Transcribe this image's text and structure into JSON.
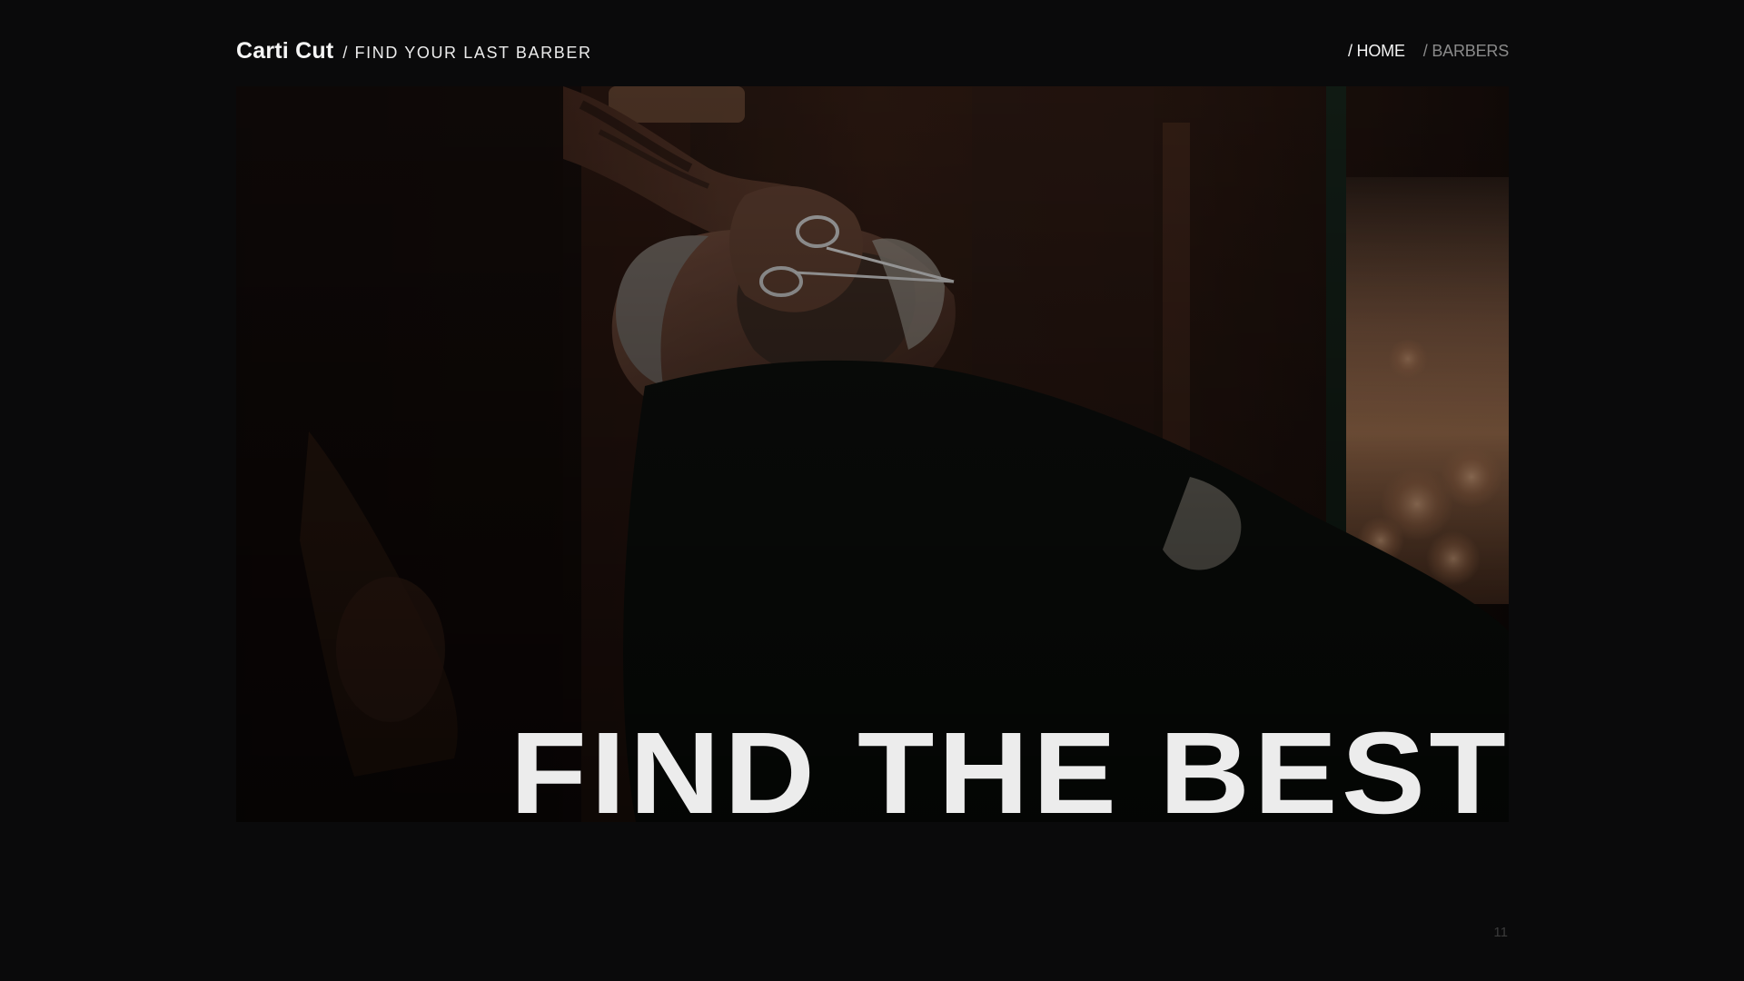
{
  "header": {
    "brand_name": "Carti Cut",
    "tagline": "/ FIND YOUR LAST BARBER"
  },
  "nav": {
    "items": [
      {
        "label": "/ HOME",
        "active": true
      },
      {
        "label": "/ BARBERS",
        "active": false
      }
    ]
  },
  "hero": {
    "headline": "FIND THE BEST",
    "image_subject": "barber trimming a client's beard with scissors"
  },
  "footer": {
    "page_number": "11"
  },
  "colors": {
    "background": "#0a0a0b",
    "headline": "#ececec",
    "nav_active": "#f4f4f4",
    "nav_inactive": "#8a8a8a"
  }
}
